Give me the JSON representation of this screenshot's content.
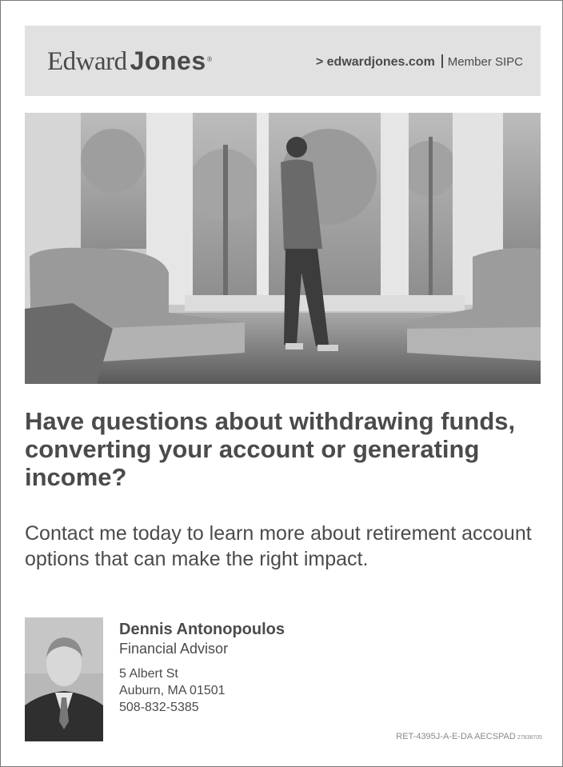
{
  "brand": {
    "logo_word1": "Edward",
    "logo_word2": "Jones",
    "logo_mark": "®",
    "website": "> edwardjones.com",
    "member": "Member SIPC"
  },
  "hero": {
    "icon": "photo-man-window-armchairs"
  },
  "headline": "Have questions about withdrawing funds, converting your account or generating income?",
  "subheadline": "Contact me today to learn more about retirement account options that can make the right impact.",
  "advisor": {
    "name": "Dennis Antonopoulos",
    "title": "Financial Advisor",
    "street": "5 Albert St",
    "city": "Auburn, MA 01501",
    "phone": "508-832-5385",
    "icon": "portrait-photo"
  },
  "footer": {
    "code": "RET-4395J-A-E-DA  AECSPAD",
    "code_small": "27838705"
  },
  "colors": {
    "header_bg": "#e1e1e1",
    "text": "#4a4a4a",
    "border": "#7a7a7a"
  }
}
